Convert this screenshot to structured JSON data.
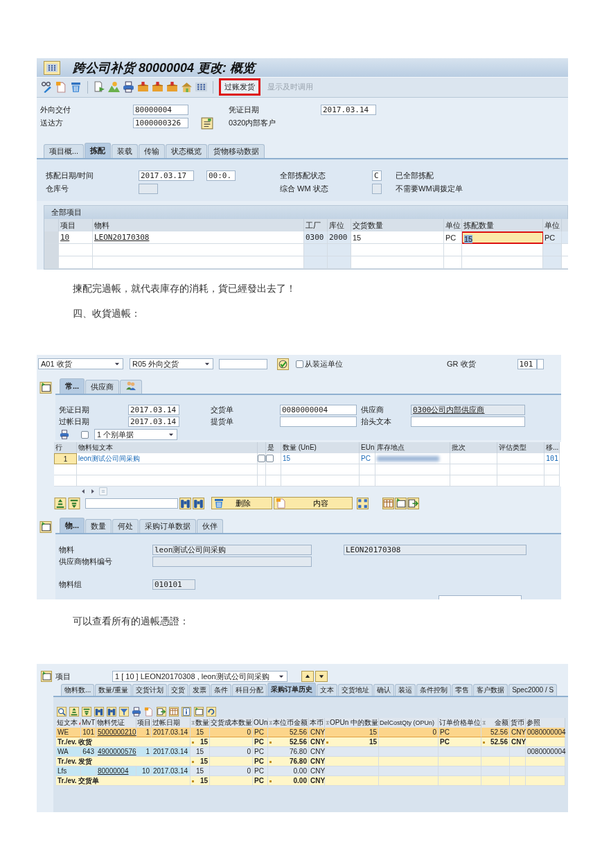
{
  "delivery_screen": {
    "title": "跨公司补货 80000004 更改: 概览",
    "toolbar": {
      "buttons": [
        {
          "label": "过账发货",
          "highlighted": true,
          "disabled": false
        },
        {
          "label": "显示及时调用",
          "highlighted": false,
          "disabled": true
        }
      ]
    },
    "header_fields": [
      {
        "label": "外向交付",
        "value": "80000004"
      },
      {
        "label": "凭证日期",
        "value": "2017.03.14"
      },
      {
        "label": "送达方",
        "value": "1000000326",
        "description": "0320内部客户"
      }
    ],
    "tabs": [
      {
        "label": "项目概...",
        "selected": false
      },
      {
        "label": "拣配",
        "selected": true
      },
      {
        "label": "装载",
        "selected": false
      },
      {
        "label": "传输",
        "selected": false
      },
      {
        "label": "状态概览",
        "selected": false
      },
      {
        "label": "货物移动数据",
        "selected": false
      }
    ],
    "picking": {
      "date_label": "拣配日期/时间",
      "date": "2017.03.17",
      "time": "00:0.",
      "status_label": "全部拣配状态",
      "status_value": "C",
      "status_text": "已全部拣配",
      "warehouse_label": "仓库号",
      "wm_label": "综合 WM 状态",
      "wm_text": "不需要WM调拨定单"
    },
    "table": {
      "title": "全部项目",
      "columns": [
        "项目",
        "物料",
        "工厂",
        "库位",
        "交货数量",
        "单位",
        "拣配数量",
        "单位"
      ],
      "rows": [
        {
          "item": "10",
          "material": "LEON20170308",
          "plant": "0300",
          "storage_location": "2000",
          "delivery_qty": "15",
          "unit": "PC",
          "picked_qty": {
            "value": "15",
            "focused": true
          },
          "picked_unit": "PC"
        }
      ]
    }
  },
  "notes_1": [
    "揀配完過帳，就代表庫存的消耗，貨已經發出去了！",
    "四、收貨過帳："
  ],
  "goods_receipt_screen": {
    "action": "A01 收货",
    "reference_type": "R05 外向交货",
    "from_handling_unit": {
      "label": "从装运单位",
      "checked": false
    },
    "movement_label": "GR 收货",
    "movement_type": "101",
    "header_tabs": [
      {
        "kind": "text",
        "label": "常...",
        "selected": true
      },
      {
        "kind": "text",
        "label": "供应商",
        "selected": false
      },
      {
        "kind": "icon",
        "selected": false
      }
    ],
    "header_fields": [
      {
        "label": "凭证日期",
        "value": "2017.03.14",
        "readonly": false
      },
      {
        "label": "交货单",
        "value": "0080000004",
        "readonly": false
      },
      {
        "label": "供应商",
        "value": "0300公司内部供应商",
        "readonly": true
      },
      {
        "label": "过帐日期",
        "value": "2017.03.14",
        "readonly": false
      },
      {
        "label": "提货单",
        "readonly": false
      },
      {
        "label": "抬头文本",
        "readonly": false
      }
    ],
    "print": {
      "checked": false,
      "output": "1 个别单据"
    },
    "items": {
      "columns": [
        "行",
        "物料短文本",
        "是",
        "数量 (UnE)",
        "EUn",
        "库存地点",
        "批次",
        "评估类型",
        "移..."
      ],
      "rows": [
        {
          "line": "1",
          "short_text": "leon测试公司间采购",
          "checks": [
            {
              "checked": false
            },
            {
              "checked": false
            }
          ],
          "qty": "15",
          "unit": "PC",
          "movement_type": "101"
        }
      ]
    },
    "toolbar": {
      "delete_button": "删除",
      "content_button": "内容"
    },
    "detail_tabs": [
      {
        "label": "物...",
        "selected": true
      },
      {
        "label": "数量",
        "selected": false
      },
      {
        "label": "何处",
        "selected": false
      },
      {
        "label": "采购订单数据",
        "selected": false
      },
      {
        "label": "伙伴",
        "selected": false
      }
    ],
    "detail_fields": [
      {
        "label": "物料",
        "value": "leon测试公司间采购",
        "code": "LEON20170308"
      },
      {
        "label": "供应商物料编号"
      },
      {
        "label": "物料组",
        "value": "010101"
      }
    ]
  },
  "notes_2": [
    "可以查看所有的過帳憑證："
  ],
  "history_screen": {
    "item_label": "项目",
    "item_value": "1 [ 10 ] LEON20170308 , leon测试公司间采购",
    "tabs": [
      {
        "label": "物料数...",
        "selected": false
      },
      {
        "label": "数量/重量",
        "selected": false
      },
      {
        "label": "交货计划",
        "selected": false
      },
      {
        "label": "交货",
        "selected": false
      },
      {
        "label": "发票",
        "selected": false
      },
      {
        "label": "条件",
        "selected": false
      },
      {
        "label": "科目分配",
        "selected": false
      },
      {
        "label": "采购订单历史",
        "selected": true
      },
      {
        "label": "文本",
        "selected": false
      },
      {
        "label": "交货地址",
        "selected": false
      },
      {
        "label": "确认",
        "selected": false
      },
      {
        "label": "装运",
        "selected": false
      },
      {
        "label": "条件控制",
        "selected": false
      },
      {
        "label": "零售",
        "selected": false
      },
      {
        "label": "客户数据",
        "selected": false
      },
      {
        "label": "Spec2000 / S",
        "selected": false
      }
    ],
    "table": {
      "columns": [
        {
          "label": "短文本",
          "sorted": true,
          "sum": false
        },
        {
          "label": "MvT",
          "sorted": false,
          "sum": false
        },
        {
          "label": "物料凭证",
          "sorted": false,
          "sum": false
        },
        {
          "label": "项目",
          "sorted": false,
          "sum": false
        },
        {
          "label": "过帐日期",
          "sorted": false,
          "sum": false
        },
        {
          "label": "数量",
          "sorted": false,
          "sum": true
        },
        {
          "label": "交货成本数量",
          "sorted": false,
          "sum": false
        },
        {
          "label": "OUn",
          "sorted": false,
          "sum": false
        },
        {
          "label": "本位币金额",
          "sorted": false,
          "sum": true
        },
        {
          "label": "本币",
          "sorted": false,
          "sum": false
        },
        {
          "label": "OPUn 中的数量",
          "sorted": false,
          "sum": true
        },
        {
          "label": "DelCostQty (OPUn)",
          "sorted": false,
          "sum": false
        },
        {
          "label": "订单价格单位",
          "sorted": false,
          "sum": false
        },
        {
          "label": "金额",
          "sorted": false,
          "sum": true
        },
        {
          "label": "货币",
          "sorted": false,
          "sum": false
        },
        {
          "label": "参照",
          "sorted": false,
          "sum": false
        }
      ],
      "rows": [
        {
          "kind": "item",
          "selected": true,
          "short_text": "WE",
          "mvt": "101",
          "doc": "5000000210",
          "item": "1",
          "date": "2017.03.14",
          "qty": "15",
          "cost_qty": "0",
          "oun": "PC",
          "local_amount": "52.56",
          "local_currency": "CNY",
          "opun_qty": "15",
          "delcost_qty": "0",
          "price_unit": "PC",
          "amount": "52.56",
          "currency": "CNY",
          "reference": "0080000004"
        },
        {
          "kind": "total",
          "selected": false,
          "short_text": "Tr./ev. 收货",
          "qty": "15",
          "oun": "PC",
          "local_amount": "52.56",
          "local_currency": "CNY",
          "opun_qty": "15",
          "price_unit": "PC",
          "amount": "52.56",
          "currency": "CNY"
        },
        {
          "kind": "item",
          "selected": false,
          "short_text": "WA",
          "mvt": "643",
          "doc": "4900000576",
          "item": "1",
          "date": "2017.03.14",
          "qty": "15",
          "cost_qty": "0",
          "oun": "PC",
          "local_amount": "76.80",
          "local_currency": "CNY",
          "reference": "0080000004"
        },
        {
          "kind": "total",
          "selected": false,
          "short_text": "Tr./ev. 发货",
          "qty": "15",
          "oun": "PC",
          "local_amount": "76.80",
          "local_currency": "CNY"
        },
        {
          "kind": "item",
          "selected": false,
          "short_text": "Lfs",
          "doc": "80000004",
          "item": "10",
          "date": "2017.03.14",
          "qty": "15",
          "cost_qty": "0",
          "oun": "PC",
          "local_amount": "0.00",
          "local_currency": "CNY"
        },
        {
          "kind": "total",
          "selected": false,
          "short_text": "Tr./ev. 交货单",
          "qty": "15",
          "oun": "PC",
          "local_amount": "0.00",
          "local_currency": "CNY"
        }
      ]
    }
  }
}
